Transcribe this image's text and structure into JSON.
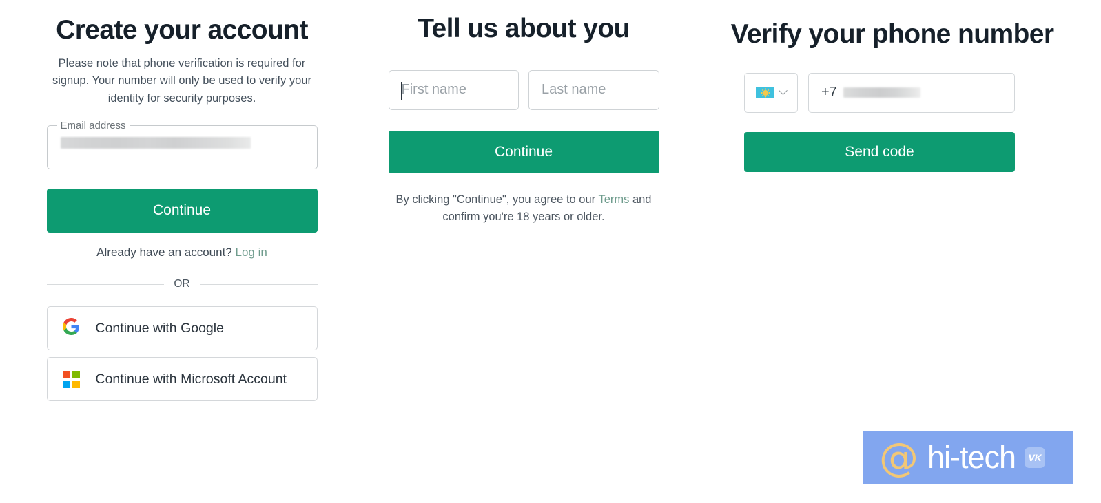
{
  "theme": {
    "page_background": "#ffffff",
    "primary_button": "#0d9b71",
    "heading_color": "#16202a",
    "body_text": "#44505c",
    "link_muted": "#6f9c8d",
    "field_border": "#c6cacd",
    "watermark_background": "#82a6ef",
    "watermark_at_color": "#f2c776"
  },
  "signup": {
    "heading": "Create your account",
    "note": "Please note that phone verification is required for signup. Your number will only be used to verify your identity for security purposes.",
    "email_label": "Email address",
    "email_value": "",
    "email_value_state": "redacted",
    "continue_label": "Continue",
    "already_text": "Already have an account?",
    "login_label": "Log in",
    "divider_label": "OR",
    "google_label": "Continue with Google",
    "google_icon": "google-logo-icon",
    "microsoft_label": "Continue with Microsoft Account",
    "microsoft_icon": "microsoft-logo-icon",
    "microsoft_colors": [
      "#f25022",
      "#7fba00",
      "#00a4ef",
      "#ffb900"
    ]
  },
  "about": {
    "heading": "Tell us about you",
    "first_name_placeholder": "First name",
    "first_name_value": "",
    "last_name_placeholder": "Last name",
    "last_name_value": "",
    "continue_label": "Continue",
    "terms_prefix": "By clicking \"Continue\", you agree to our",
    "terms_link": "Terms",
    "terms_suffix": "and confirm you're 18 years or older."
  },
  "phone": {
    "heading": "Verify your phone number",
    "country_flag_icon": "kazakhstan-flag-icon",
    "country_flag_name": "Kazakhstan",
    "chevron_icon": "chevron-down-icon",
    "dial_code": "+7",
    "number_value": "",
    "number_value_state": "redacted",
    "send_code_label": "Send code"
  },
  "watermark": {
    "at_symbol": "@",
    "text": "hi-tech",
    "badge_label": "VK"
  }
}
